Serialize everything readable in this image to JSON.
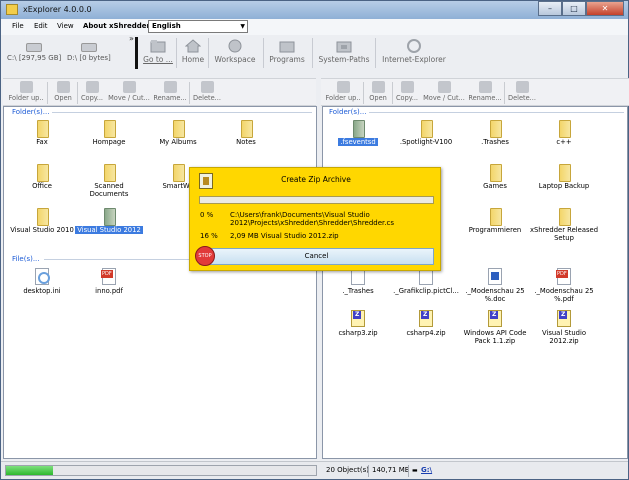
{
  "window": {
    "title": "xExplorer 4.0.0.0",
    "min": "–",
    "max": "□",
    "close": "✕"
  },
  "menu": {
    "file": "File",
    "edit": "Edit",
    "view": "View",
    "about": "About xShredder",
    "language": "English"
  },
  "drives": [
    {
      "label": "C:\\ [297,95 GB]"
    },
    {
      "label": "D:\\ [0 bytes]"
    }
  ],
  "quickbar": {
    "chevron": "»",
    "goto": "Go to ...",
    "home": "Home",
    "workspace": "Workspace",
    "programs": "Programs",
    "system_paths": "System-Paths",
    "internet_explorer": "Internet-Explorer"
  },
  "pane_toolbar": {
    "folder_up": "Folder up..",
    "open": "Open",
    "copy": "Copy...",
    "move_cut": "Move / Cut...",
    "rename": "Rename...",
    "delete": "Delete..."
  },
  "left_pane": {
    "folders_label": "Folder(s)...",
    "files_label": "File(s)...",
    "folders": [
      "Fax",
      "Hompage",
      "My Albums",
      "Notes",
      "Office",
      "Scanned Documents",
      "SmartWo",
      "Visual Studio 2010",
      "Visual Studio 2012"
    ],
    "files": [
      "desktop.ini",
      "inno.pdf"
    ]
  },
  "right_pane": {
    "folders_label": "Folder(s)...",
    "folders": [
      ".fseventsd",
      ".Spotlight-V100",
      ".Trashes",
      "c++",
      "Games",
      "Laptop Backup",
      "Programmieren",
      "xShredder Released Setup"
    ],
    "files": [
      "._Trashes",
      "._Grafikclip.pictCl...",
      "._Modenschau 25 %.doc",
      "._Modenschau 25 %.pdf",
      "csharp3.zip",
      "csharp4.zip",
      "Windows API Code Pack 1.1.zip",
      "Visual Studio 2012.zip"
    ]
  },
  "dialog": {
    "title": "Create Zip Archive",
    "row1_pct": "0 %",
    "row1_text": "C:\\Users\\frank\\Documents\\Visual Studio 2012\\Projects\\xShredder\\Shredder\\Shredder.cs",
    "row2_pct": "16 %",
    "row2_text": "2,09 MB  Visual Studio 2012.zip",
    "cancel": "Cancel",
    "stop": "STOP"
  },
  "status": {
    "progress": 0.15,
    "objects": "20 Object(s)",
    "size": "140,71 MB",
    "drive": "G:\\"
  }
}
